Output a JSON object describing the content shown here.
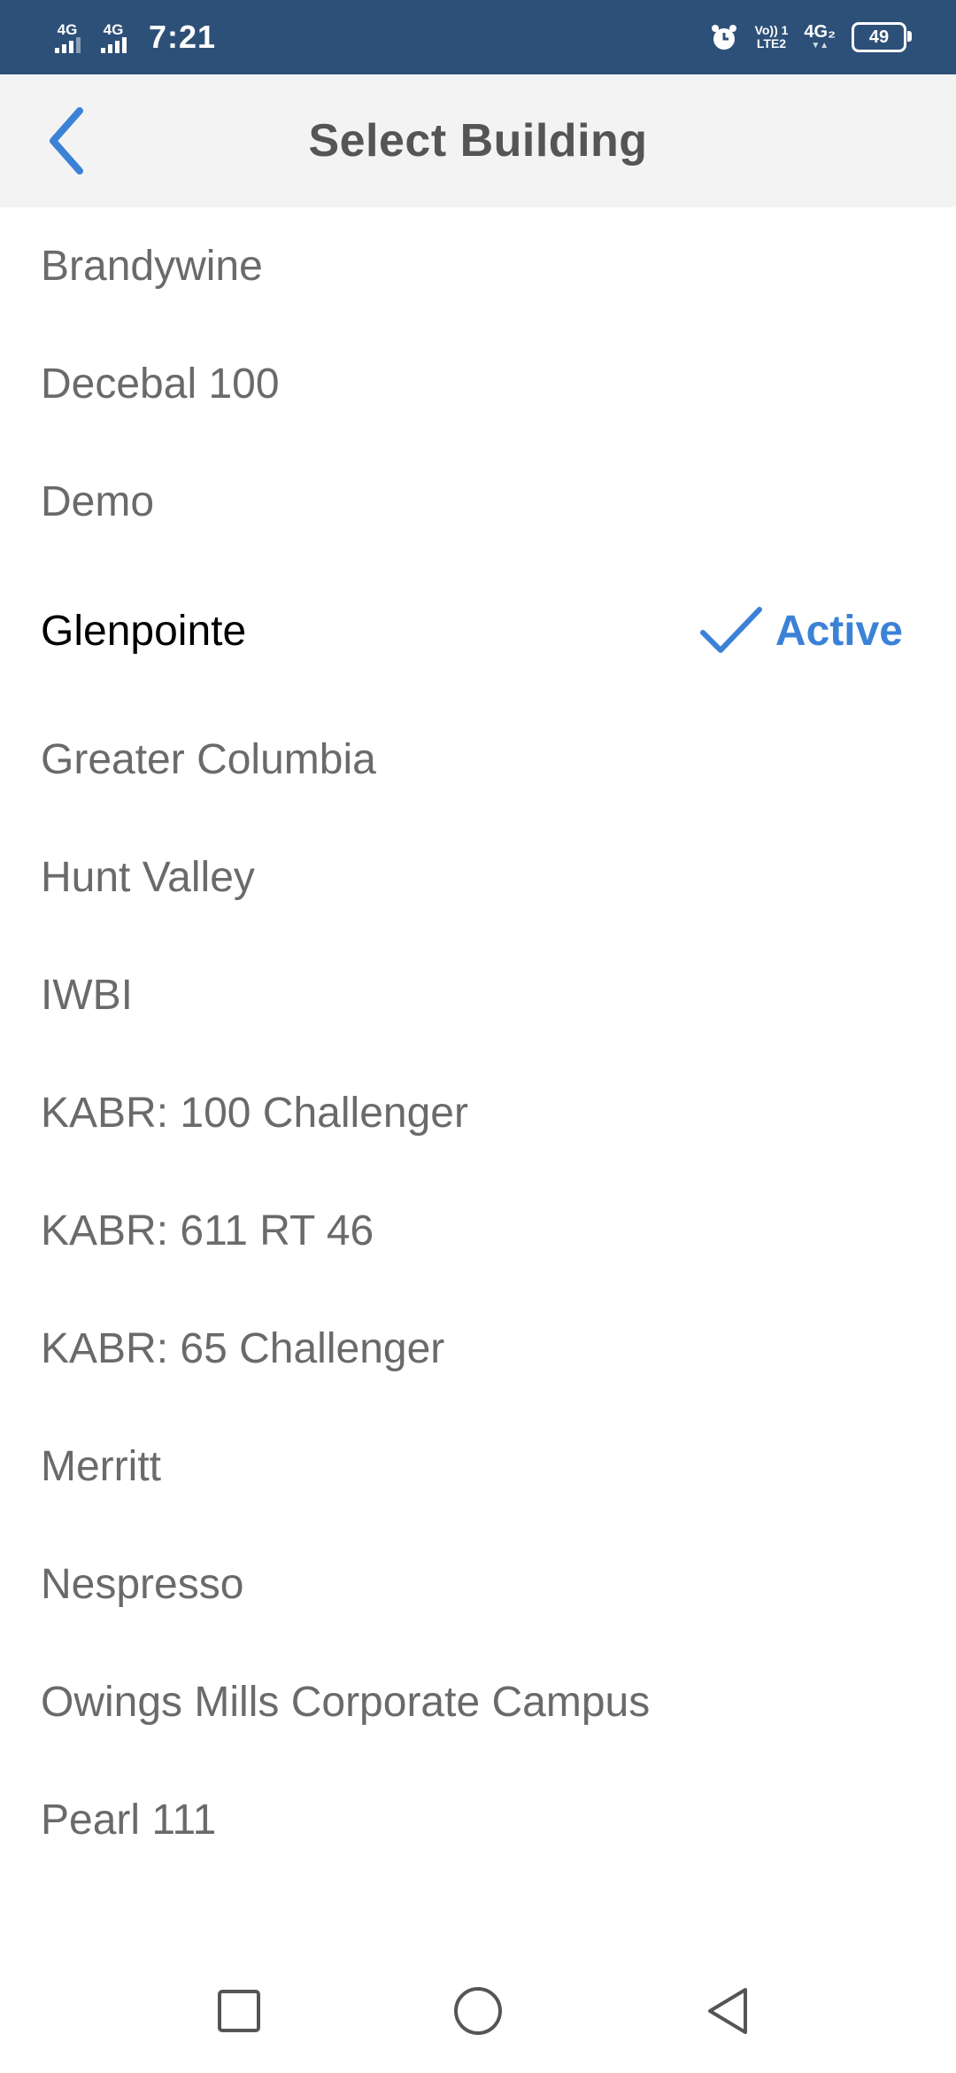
{
  "status_bar": {
    "net1": "4G",
    "net2": "4G",
    "time": "7:21",
    "volte_top": "Vo)) 1",
    "volte_bottom": "LTE2",
    "net3": "4G₂",
    "battery": "49",
    "icons": [
      "signal-icon",
      "alarm-icon",
      "battery-icon"
    ]
  },
  "header": {
    "title": "Select Building",
    "back_icon": "chevron-left-icon"
  },
  "buildings": [
    {
      "label": "Brandywine",
      "active": false
    },
    {
      "label": "Decebal 100",
      "active": false
    },
    {
      "label": "Demo",
      "active": false
    },
    {
      "label": "Glenpointe",
      "active": true
    },
    {
      "label": "Greater Columbia",
      "active": false
    },
    {
      "label": "Hunt Valley",
      "active": false
    },
    {
      "label": "IWBI",
      "active": false
    },
    {
      "label": "KABR: 100 Challenger",
      "active": false
    },
    {
      "label": "KABR: 611 RT 46",
      "active": false
    },
    {
      "label": "KABR: 65 Challenger",
      "active": false
    },
    {
      "label": "Merritt",
      "active": false
    },
    {
      "label": "Nespresso",
      "active": false
    },
    {
      "label": "Owings Mills Corporate Campus",
      "active": false
    },
    {
      "label": "Pearl 111",
      "active": false
    }
  ],
  "active_label": "Active",
  "colors": {
    "status_bar": "#2d5078",
    "header_bg": "#f3f3f3",
    "accent": "#3b82d6",
    "title": "#555555",
    "item_text": "#6a6a6a",
    "active_item_text": "#000000"
  },
  "nav_bar": {
    "icons": [
      "recents-square-icon",
      "home-circle-icon",
      "back-triangle-icon"
    ]
  }
}
